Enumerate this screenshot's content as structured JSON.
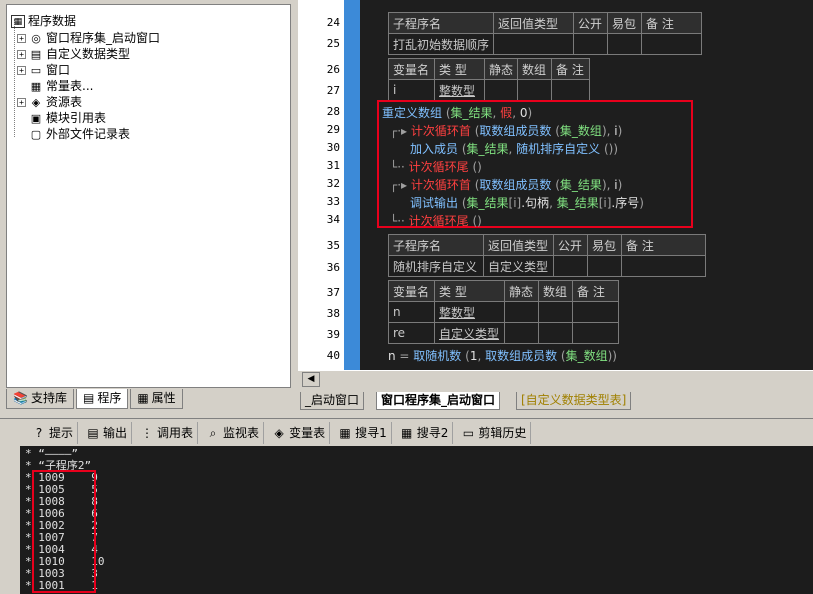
{
  "tree": {
    "root": "程序数据",
    "items": [
      {
        "label": "窗口程序集_启动窗口",
        "expand": "+",
        "icon": "◎"
      },
      {
        "label": "自定义数据类型",
        "expand": "+",
        "icon": "▤"
      },
      {
        "label": "窗口",
        "expand": "+",
        "icon": "▭"
      },
      {
        "label": "常量表...",
        "expand": "",
        "icon": "▦"
      },
      {
        "label": "资源表",
        "expand": "+",
        "icon": "◈"
      },
      {
        "label": "模块引用表",
        "expand": "",
        "icon": "▣"
      },
      {
        "label": "外部文件记录表",
        "expand": "",
        "icon": "▢"
      }
    ]
  },
  "left_tabs": [
    "支持库",
    "程序",
    "属性"
  ],
  "line_numbers": [
    "24",
    "25",
    "26",
    "27",
    "28",
    "29",
    "30",
    "31",
    "32",
    "33",
    "34",
    "35",
    "36",
    "37",
    "38",
    "39",
    "40"
  ],
  "code": {
    "sub1_header": [
      "子程序名",
      "返回值类型",
      "公开",
      "易包",
      "备 注"
    ],
    "sub1_name": "打乱初始数据顺序",
    "var1_header": [
      "变量名",
      "类 型",
      "静态",
      "数组",
      "备 注"
    ],
    "var1_row": [
      "i",
      "整数型"
    ],
    "l28": {
      "fn": "重定义数组",
      "a": "集_结果",
      "b": "假",
      "c": "0"
    },
    "l29": {
      "kw": "计次循环首",
      "fn": "取数组成员数",
      "a": "集_数组",
      "b": "i"
    },
    "l30": {
      "fn": "加入成员",
      "a": "集_结果",
      "b": "随机排序自定义"
    },
    "l31": {
      "kw": "计次循环尾"
    },
    "l32": {
      "kw": "计次循环首",
      "fn": "取数组成员数",
      "a": "集_结果",
      "b": "i"
    },
    "l33": {
      "fn": "调试输出",
      "a": "集_结果",
      "i1": "[i]",
      "p1": ".句柄",
      "b": "集_结果",
      "i2": "[i]",
      "p2": ".序号"
    },
    "l34": {
      "kw": "计次循环尾"
    },
    "sub2_header": [
      "子程序名",
      "返回值类型",
      "公开",
      "易包",
      "备 注"
    ],
    "sub2_name": "随机排序自定义",
    "sub2_ret": "自定义类型",
    "var2_header": [
      "变量名",
      "类 型",
      "静态",
      "数组",
      "备 注"
    ],
    "var2_rows": [
      [
        "n",
        "整数型"
      ],
      [
        "re",
        "自定义类型"
      ]
    ],
    "l40": {
      "v": "n",
      "fn": "取随机数",
      "a": "1",
      "b": "取数组成员数",
      "c": "集_数组"
    }
  },
  "code_tabs": [
    "_启动窗口",
    "窗口程序集_启动窗口",
    "[自定义数据类型表]"
  ],
  "toolbar": [
    "提示",
    "输出",
    "调用表",
    "监视表",
    "变量表",
    "搜寻1",
    "搜寻2",
    "剪辑历史"
  ],
  "output_lines": [
    "* “————”",
    "* “子程序2”",
    "* 1009    9",
    "* 1005    5",
    "* 1008    8",
    "* 1006    6",
    "* 1002    2",
    "* 1007    7",
    "* 1004    4",
    "* 1010    10",
    "* 1003    3",
    "* 1001    1"
  ]
}
